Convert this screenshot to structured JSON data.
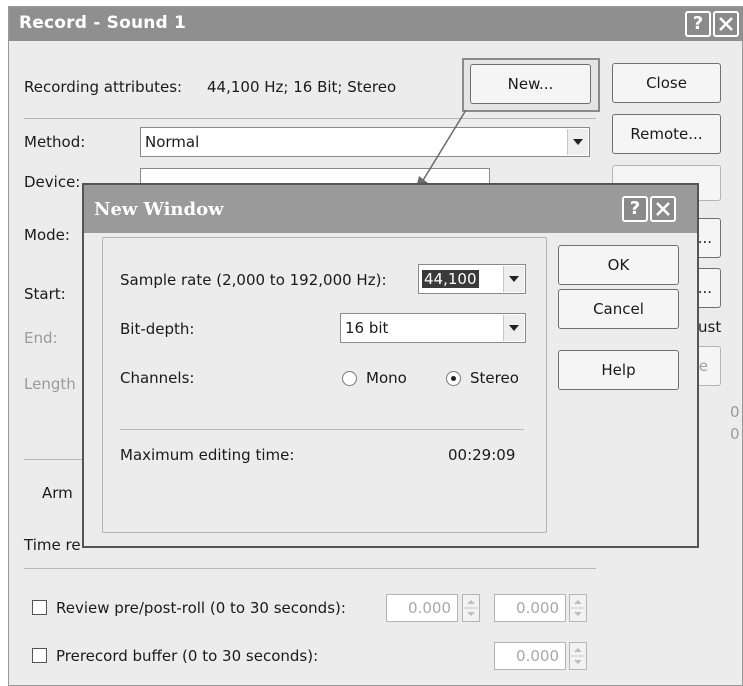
{
  "window": {
    "title": "Record - Sound 1",
    "help_glyph": "?",
    "recording_attributes_label": "Recording attributes:",
    "recording_attributes_value": "44,100 Hz; 16 Bit; Stereo",
    "method_label": "Method:",
    "method_value": "Normal",
    "device_label": "Device:",
    "mode_label": "Mode:",
    "start_label": "Start:",
    "end_label": "End:",
    "length_label": "Length",
    "arm_label": "Arm",
    "time_label": "Time re",
    "ust_fragment": "ust",
    "e_fragment": "e",
    "zero_1": "0",
    "zero_2": "0",
    "buttons": {
      "new": "New...",
      "close": "Close",
      "remote": "Remote...",
      "ellipsis_1": "...",
      "ellipsis_2": "...",
      "ellipsis_3": "..."
    },
    "review_label": "Review pre/post-roll (0 to 30 seconds):",
    "review_pre": "0.000",
    "review_post": "0.000",
    "prerecord_label": "Prerecord buffer (0 to 30 seconds):",
    "prerecord_value": "0.000"
  },
  "dialog": {
    "title": "New Window",
    "help_glyph": "?",
    "sample_rate_label": "Sample rate (2,000 to 192,000 Hz):",
    "sample_rate_value": "44,100",
    "bit_depth_label": "Bit-depth:",
    "bit_depth_value": "16 bit",
    "channels_label": "Channels:",
    "mono_label": "Mono",
    "stereo_label": "Stereo",
    "channel_selected": "Stereo",
    "max_time_label": "Maximum editing time:",
    "max_time_value": "00:29:09",
    "ok_label": "OK",
    "cancel_label": "Cancel",
    "help_label": "Help"
  },
  "icons": [
    "help-icon",
    "close-icon",
    "dropdown-arrow-icon",
    "spin-up-icon",
    "spin-down-icon"
  ]
}
